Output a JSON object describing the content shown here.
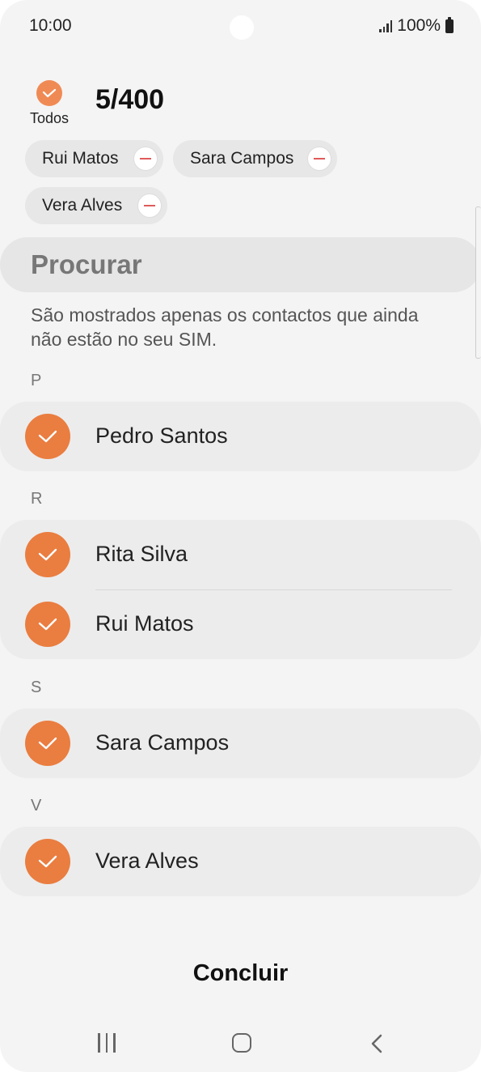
{
  "status_bar": {
    "time": "10:00",
    "battery": "100%"
  },
  "header": {
    "select_all_label": "Todos",
    "count": "5/400"
  },
  "chips": [
    {
      "label": "Rui Matos"
    },
    {
      "label": "Sara Campos"
    },
    {
      "label": "Vera Alves"
    }
  ],
  "search": {
    "placeholder": "Procurar"
  },
  "info_text": "São mostrados apenas os contactos que ainda não estão no seu SIM.",
  "sections": [
    {
      "letter": "P",
      "contacts": [
        {
          "name": "Pedro Santos",
          "checked": true
        }
      ]
    },
    {
      "letter": "R",
      "contacts": [
        {
          "name": "Rita Silva",
          "checked": true
        },
        {
          "name": "Rui Matos",
          "checked": true
        }
      ]
    },
    {
      "letter": "S",
      "contacts": [
        {
          "name": "Sara Campos",
          "checked": true
        }
      ]
    },
    {
      "letter": "V",
      "contacts": [
        {
          "name": "Vera Alves",
          "checked": true
        }
      ]
    }
  ],
  "footer": {
    "done_label": "Concluir"
  },
  "nav_icons": [
    "recent-apps-icon",
    "home-icon",
    "back-icon"
  ],
  "colors": {
    "accent": "#ea7d40",
    "background": "#f4f4f4",
    "card": "#ececec"
  }
}
